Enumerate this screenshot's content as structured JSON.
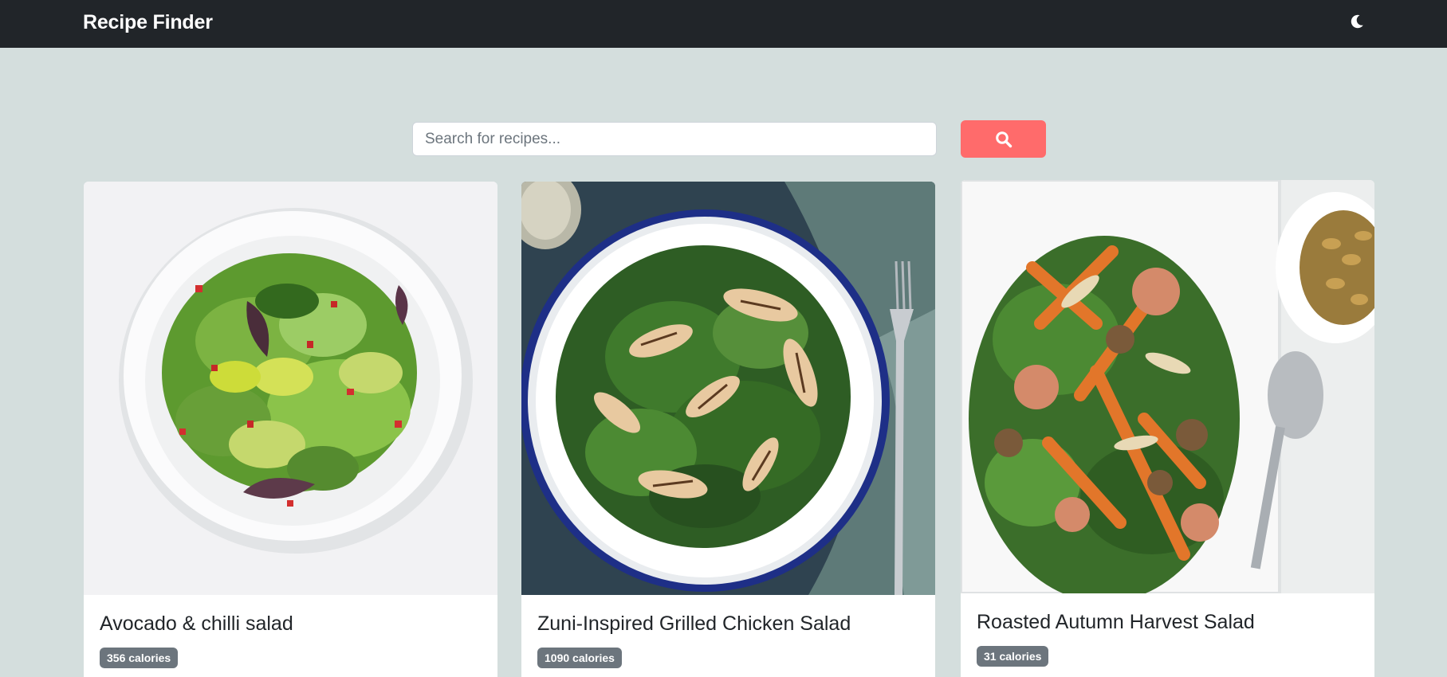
{
  "navbar": {
    "brand": "Recipe Finder",
    "theme_toggle_icon": "moon-icon"
  },
  "search": {
    "placeholder": "Search for recipes...",
    "value": "",
    "button_icon": "search-icon",
    "button_color": "#ff6b6b"
  },
  "colors": {
    "page_background": "#d4dedd",
    "navbar_background": "#212529",
    "badge_background": "#6c757d"
  },
  "recipes": [
    {
      "title": "Avocado & chilli salad",
      "calories": "356 calories",
      "image_icon": "salad-photo"
    },
    {
      "title": "Zuni-Inspired Grilled Chicken Salad",
      "calories": "1090 calories",
      "image_icon": "salad-photo"
    },
    {
      "title": "Roasted Autumn Harvest Salad",
      "calories": "31 calories",
      "image_icon": "salad-photo"
    }
  ]
}
